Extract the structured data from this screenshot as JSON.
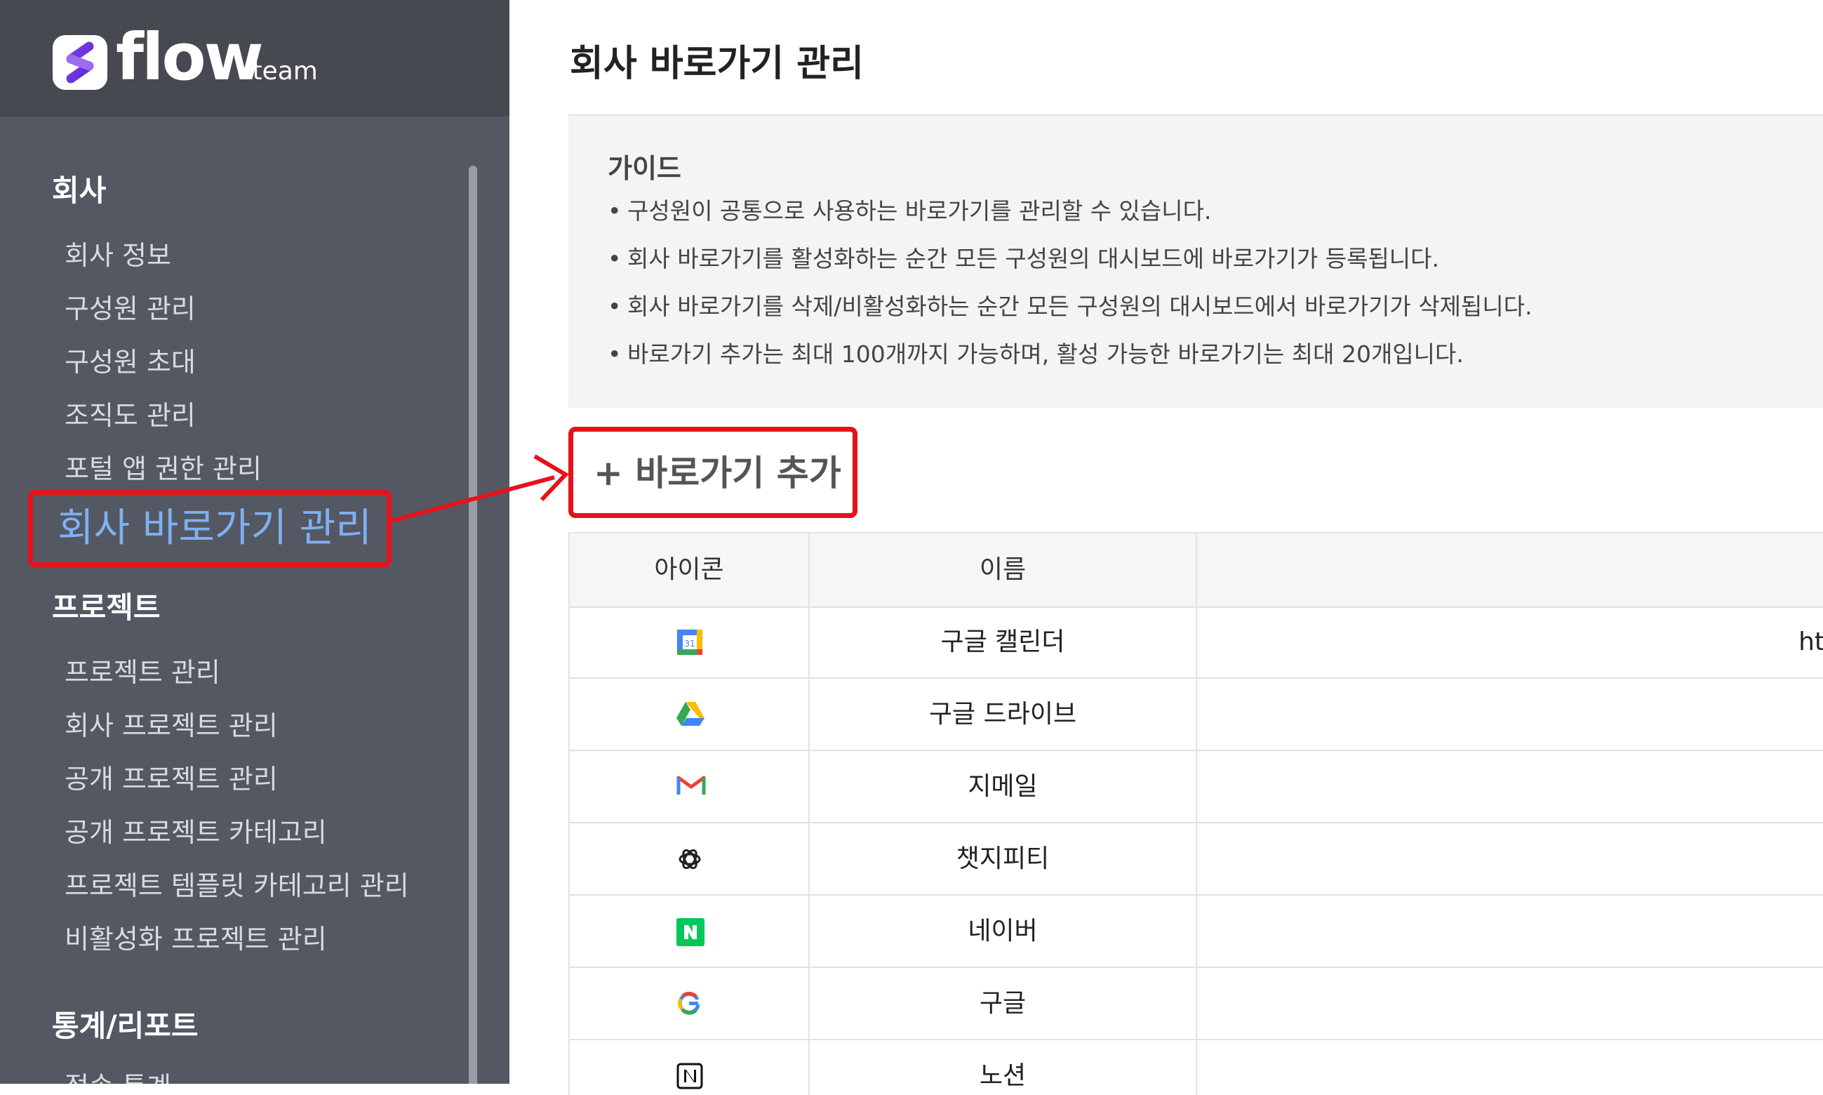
{
  "sidebar": {
    "logo": {
      "word": "flow",
      "sub": ".team"
    },
    "sections": [
      {
        "title": "회사",
        "items": [
          "회사 정보",
          "구성원 관리",
          "구성원 초대",
          "조직도 관리",
          "포털 앱 권한 관리"
        ]
      },
      {
        "title": "프로젝트",
        "items": [
          "프로젝트 관리",
          "회사 프로젝트 관리",
          "공개 프로젝트 관리",
          "공개 프로젝트 카테고리",
          "프로젝트 템플릿 카테고리 관리",
          "비활성화 프로젝트 관리"
        ]
      },
      {
        "title": "통계/리포트",
        "items": [
          "접속 통계"
        ]
      }
    ],
    "active_item": "회사 바로가기 관리"
  },
  "main": {
    "title": "회사 바로가기 관리",
    "guide": {
      "title": "가이드",
      "bullet": "•",
      "items": [
        "구성원이 공통으로 사용하는 바로가기를 관리할 수 있습니다.",
        "회사 바로가기를 활성화하는 순간 모든 구성원의 대시보드에 바로가기가 등록됩니다.",
        "회사 바로가기를 삭제/비활성화하는 순간 모든 구성원의 대시보드에서 바로가기가 삭제됩니다.",
        "바로가기 추가는 최대 100개까지 가능하며, 활성 가능한 바로가기는 최대 20개입니다."
      ]
    },
    "add_button": "+ 바로가기 추가",
    "table": {
      "headers": {
        "icon": "아이콘",
        "name": "이름"
      },
      "rows": [
        {
          "icon": "google-calendar-icon",
          "name": "구글 캘린더",
          "url": "ht"
        },
        {
          "icon": "google-drive-icon",
          "name": "구글 드라이브",
          "url": ""
        },
        {
          "icon": "gmail-icon",
          "name": "지메일",
          "url": ""
        },
        {
          "icon": "chatgpt-icon",
          "name": "챗지피티",
          "url": ""
        },
        {
          "icon": "naver-icon",
          "name": "네이버",
          "url": ""
        },
        {
          "icon": "google-icon",
          "name": "구글",
          "url": ""
        },
        {
          "icon": "notion-icon",
          "name": "노션",
          "url": ""
        }
      ]
    }
  },
  "colors": {
    "sidebar_bg": "#545862",
    "logo_bar_bg": "#46494f",
    "active_text": "#7fb0f2",
    "highlight_red": "#e8111a",
    "guide_bg": "#f4f4f5"
  }
}
